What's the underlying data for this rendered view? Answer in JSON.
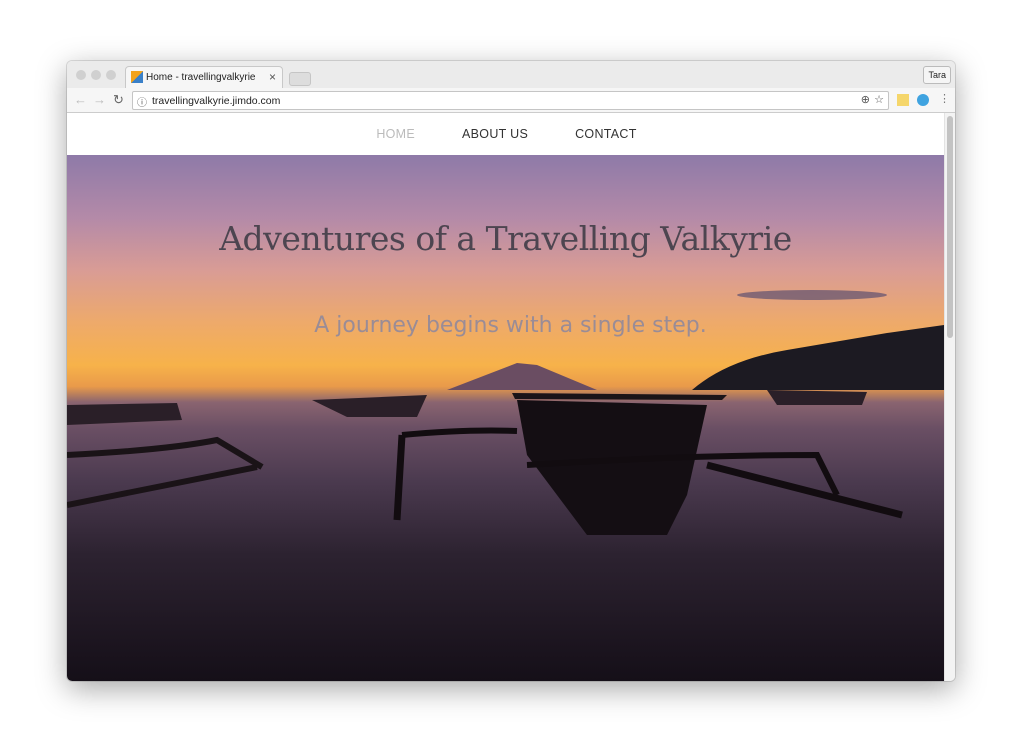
{
  "browser": {
    "tab_title": "Home - travellingvalkyrie",
    "url": "travellingvalkyrie.jimdo.com",
    "profile": "Tara",
    "close_icon": "×"
  },
  "nav": {
    "items": [
      {
        "label": "HOME",
        "active": true
      },
      {
        "label": "ABOUT US"
      },
      {
        "label": "CONTACT"
      }
    ]
  },
  "hero": {
    "title": "Adventures of a Travelling Valkyrie",
    "subtitle": "A journey begins with a single step."
  }
}
